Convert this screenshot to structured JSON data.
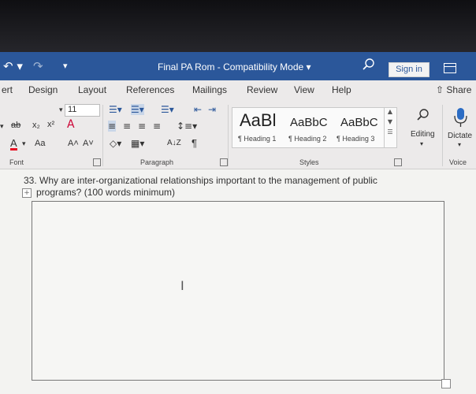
{
  "titlebar": {
    "title": "Final PA Rom  -  Compatibility Mode  ▾",
    "signin": "Sign in"
  },
  "menubar": {
    "tabs": [
      "ert",
      "Design",
      "Layout",
      "References",
      "Mailings",
      "Review",
      "View",
      "Help"
    ],
    "share": "Share"
  },
  "ribbon": {
    "font": {
      "size": "11",
      "strike": "ab",
      "subscript": "x₂",
      "superscript": "x²",
      "font_color": "A",
      "change_case": "Aa",
      "grow": "A˄",
      "shrink": "A˅",
      "label": "Font"
    },
    "paragraph": {
      "label": "Paragraph",
      "sort": "A↓Z",
      "pilcrow": "¶"
    },
    "styles": {
      "samples": [
        "AaBbC",
        "AaBbC",
        "AaBbC"
      ],
      "sample_visible": [
        "AaBl",
        "AaBbC",
        "AaBbC"
      ],
      "names": [
        "¶ Heading 1",
        "¶ Heading 2",
        "¶ Heading 3"
      ],
      "label": "Styles"
    },
    "editing": {
      "label": "Editing"
    },
    "voice": {
      "dictate": "Dictate",
      "label": "Voice"
    }
  },
  "document": {
    "question_line1": "33. Why are inter-organizational relationships important to the management of public",
    "question_line2": "programs? (100 words minimum)",
    "answer_value": ""
  },
  "colors": {
    "titlebar": "#2b579a",
    "ribbon": "#eceaea",
    "font_color_bar": "#e81123"
  }
}
